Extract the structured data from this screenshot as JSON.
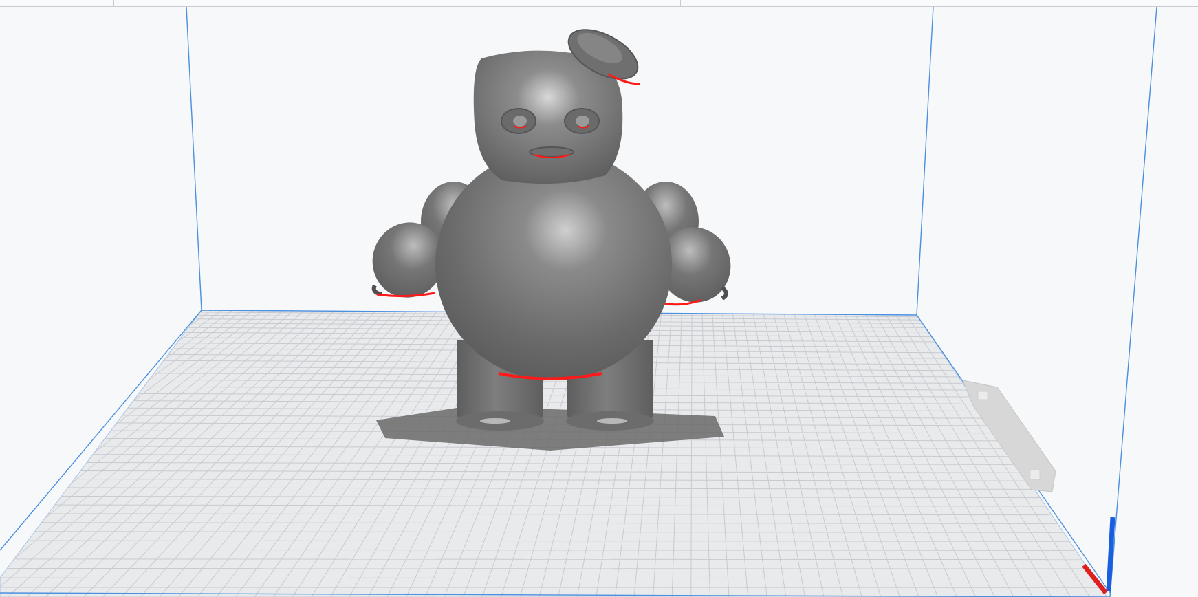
{
  "app": {
    "view": "3d-build-volume-viewport"
  },
  "colors": {
    "background": "#f7f8f9",
    "build_plate": "#e9eaec",
    "grid_line": "#c4c7cb",
    "volume_edge": "#4a90e2",
    "model": "#6e6e6e",
    "overhang": "#ff1a1a",
    "axis_x": "#e02020",
    "axis_z": "#1a5fe0"
  },
  "icons": {
    "model": "3d-model-figure",
    "axes": "axis-gizmo"
  }
}
